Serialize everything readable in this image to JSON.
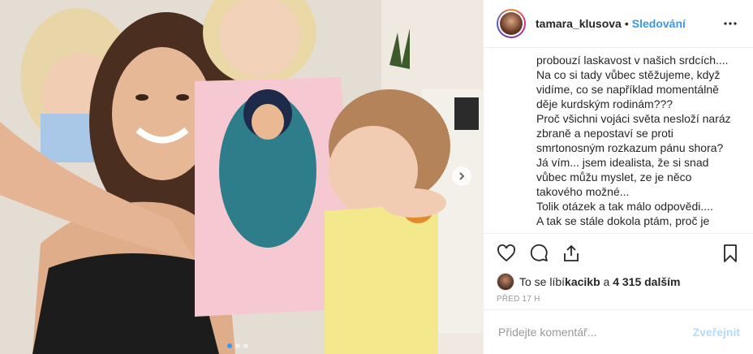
{
  "photo": {
    "alt": "",
    "carousel_dots": 3,
    "active_dot": 0,
    "next_icon": "chevron-right-icon"
  },
  "header": {
    "username": "tamara_klusova",
    "separator": "•",
    "follow_label": "Sledování",
    "more_icon": "more-options-icon"
  },
  "caption": {
    "lines": [
      "probouzí laskavost v našich srdcích....",
      "Na co si tady vůbec stěžujeme, když",
      "vidíme, co se například momentálně",
      "děje kurdským rodinám???",
      "Proč všichni vojáci světa nesloží naráz",
      "zbraně a nepostaví se proti",
      "smrtonosným rozkazum pánu shora?",
      "Já vím... jsem idealista, že si snad",
      "vůbec můžu myslet, ze je něco",
      "takového možné...",
      "Tolik otázek a tak málo odpovědi....",
      "A tak se stále dokola ptám, proč je"
    ]
  },
  "actions": {
    "like_icon": "heart-icon",
    "comment_icon": "comment-icon",
    "share_icon": "share-icon",
    "save_icon": "bookmark-icon"
  },
  "likes": {
    "prefix": "To se líbí ",
    "user": "kacikb",
    "middle": " a ",
    "count": "4 315 dalším"
  },
  "time": "Před 17 h",
  "comment": {
    "placeholder": "Přidejte komentář...",
    "publish_label": "Zveřejnit"
  },
  "colors": {
    "accent": "#3897f0",
    "publish_disabled": "#b3dbff",
    "text": "#262626",
    "muted": "#999999"
  }
}
